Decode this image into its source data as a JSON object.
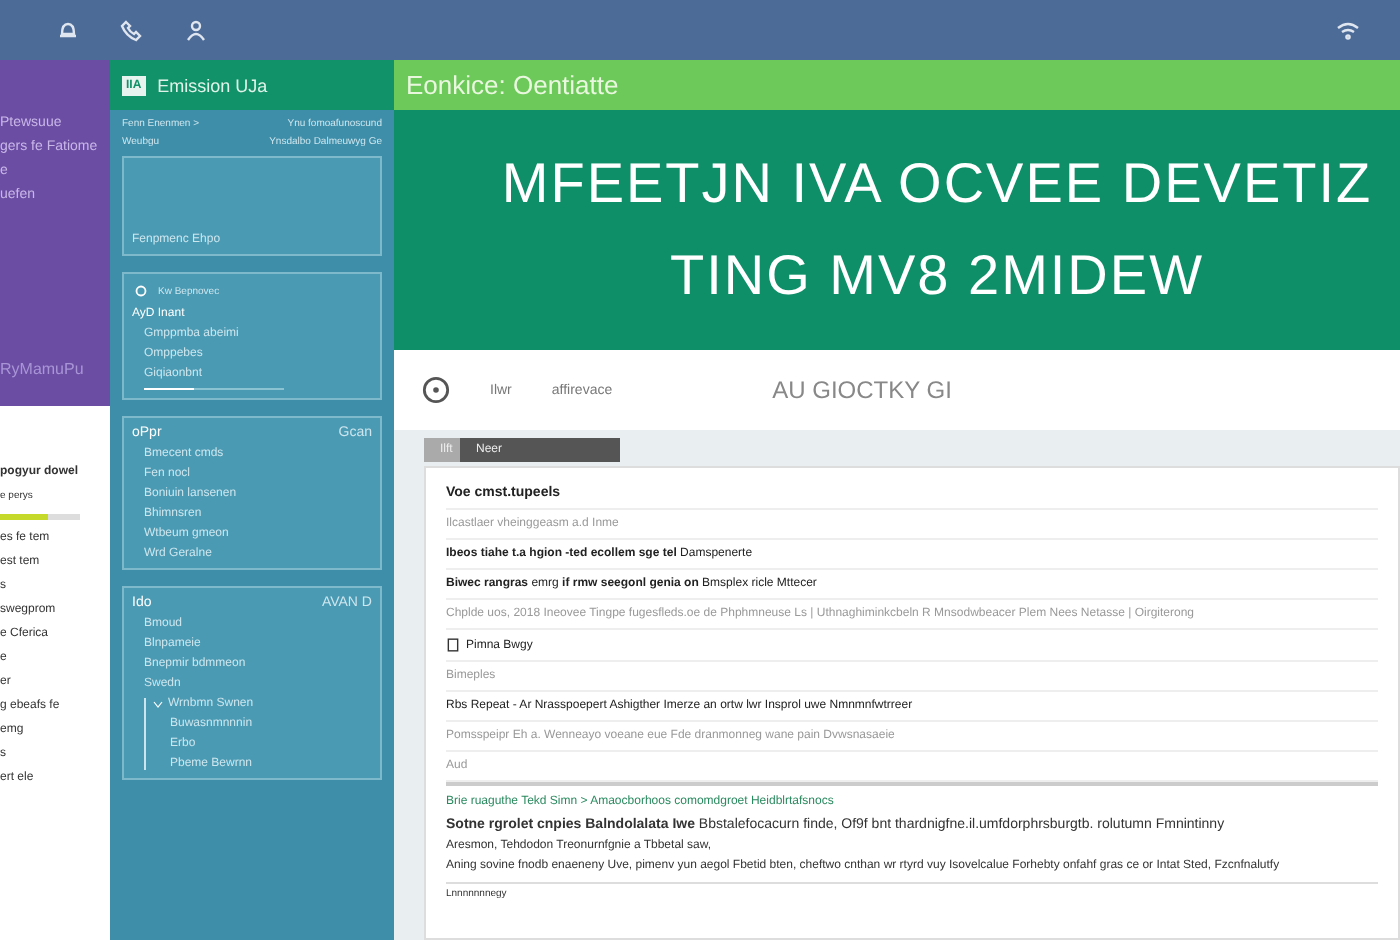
{
  "left_sidebar": {
    "items": [
      "Ptewsuue",
      "gers fe Fatiome",
      "e",
      "uefen"
    ],
    "footer": "RyMamuPu",
    "progress": {
      "title": "pogyur dowel",
      "caption": "e perys",
      "level": 0.6
    },
    "list": [
      "es fe tem",
      "est tem",
      "s",
      "swegprom",
      "e  Cferica",
      "e",
      "er",
      "g ebeafs fe",
      "emg",
      "s",
      "ert ele"
    ]
  },
  "panel": {
    "logo": "IIA",
    "title": "Emission UJa",
    "breadcrumb": [
      "Fenn Enenmen  >",
      "Ynu fomoafunoscund"
    ],
    "subline": [
      "Weubgu",
      "Ynsdalbo Dalmeuwyg Ge"
    ],
    "inner_box": "Fenpmenc Ehpo",
    "card_title": "Kw Bepnovec",
    "subsection": "AyD Inant",
    "sub_rows": [
      "Gmppmba abeimi",
      "Omppebes",
      "Giqiaonbnt"
    ],
    "slider": {
      "level": 0.35
    },
    "groups": [
      {
        "title": "oPpr",
        "aside": "Gcan",
        "items": [
          "Bmecent cmds",
          "Fen nocl",
          "Boniuin lansenen",
          "Bhimnsren",
          "Wtbeum gmeon",
          "Wrd Geralne"
        ]
      },
      {
        "title": "Ido",
        "aside": "AVAN D",
        "items": [
          "Bmoud",
          "Blnpameie",
          "Bnepmir bdmmeon",
          "Swedn"
        ],
        "tree": {
          "label": "Wrnbmn Swnen",
          "expanded": true,
          "children": [
            "Buwasnmnnnin",
            "Erbo",
            "Pbeme Bewrnn"
          ]
        }
      }
    ]
  },
  "banner": {
    "title": "Eonkice: Oentiatte",
    "headline": [
      "MFEETJN IVA OCVEE DEVETIZ",
      "TING MV8 2MIDEW"
    ]
  },
  "toolbar": {
    "items": [
      "Ilwr",
      "affirevace"
    ],
    "caption": "AU GIOCTKY GI"
  },
  "tabs": [
    {
      "label": "Ilft",
      "selected": false
    },
    {
      "label": "Neer",
      "selected": true
    }
  ],
  "content": {
    "rows": [
      {
        "kind": "heading",
        "text": "Voe cmst.tupeels"
      },
      {
        "kind": "muted",
        "text": "Ilcastlaer vheinggeasm a.d  Inme"
      },
      {
        "kind": "text",
        "text": "**Ibeos tiahe t.a hgion -ted ecollem sge tel** Damspenerte"
      },
      {
        "kind": "text",
        "text": "**Biwec rangras** emrg **if rmw seegonl genia on** Bmsplex ricle Mttecer"
      },
      {
        "kind": "muted",
        "text": "Chplde uos, 2018  Ineovee  Tingpe fugesfleds.oe  de  Phphmneuse  Ls  |  Uthnaghiminkcbeln  R  Mnsodwbeacer   Plem Nees   Netasse  |   Oirgiterong"
      },
      {
        "kind": "icon",
        "text": "Pimna Bwgy"
      },
      {
        "kind": "muted",
        "text": "Bimeples"
      },
      {
        "kind": "text",
        "text": "Rbs Repeat - Ar Nrasspoepert Ashigther Imerze an ortw lwr Insprol uwe Nmnmnfwtrreer"
      },
      {
        "kind": "muted",
        "text": "Pomsspeipr Eh a. Wenneayo voeane eue Fde dranmonneg wane pain Dvwsnasaeie"
      },
      {
        "kind": "muted",
        "text": "Aud"
      }
    ],
    "section": {
      "heading": "Brie ruaguthe Tekd Simn  >  Amaocborhoos comomdgroet Heidblrtafsnocs",
      "paragraph": "**Sotne rgrolet cnpies Balndolalata Iwe** Bbstalefocacurn finde, Of9f bnt thardnigfne.il.umfdorphrsburgtb. rolutumn Fmnintinny",
      "lines": [
        "Aresmon, Tehdodon Treonurnfgnie a Tbbetal saw,",
        "Aning sovine fnodb enaeneny Uve, pimenv yun aegol Fbetid bten, cheftwo cnthan wr rtyrd vuy Isovelcalue Forhebty onfahf gras ce or Intat Sted, Fzcnfnalutfy"
      ],
      "footer": "Lnnnnnnnegy"
    }
  }
}
